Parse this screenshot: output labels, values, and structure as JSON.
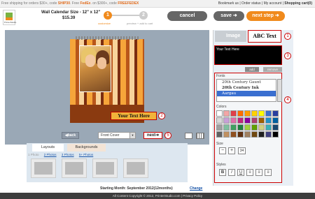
{
  "topbar": {
    "promo_a": "Free shipping for orders $30+, code ",
    "promo_code1": "SHIP30",
    "promo_b": ". Free ",
    "promo_brand": "FedEx",
    "promo_c": ". on $300+, code ",
    "promo_code2": "FREEFEDEX",
    "links": [
      "Bookmark us",
      "Order status",
      "My account",
      "Shopping cart(0)"
    ]
  },
  "header": {
    "logo_text": "PrinterStudio",
    "product_title": "Wall Calendar Size - 12\" x 12\"",
    "price": "$15.39",
    "step1_number": "1",
    "step1_label": "customize",
    "step2_number": "2",
    "step2_label": "preview + add to cart",
    "cancel_label": "cancel",
    "save_label": "save",
    "next_step_label": "next step"
  },
  "canvas": {
    "calendar_text": "Your Text Here",
    "callout2": "2",
    "callout5": "5",
    "back_label": "back",
    "page_select_value": "Front Cover",
    "next_label": "next"
  },
  "layouts": {
    "tabs": [
      "Layouts",
      "Backgrounds"
    ],
    "subtabs": [
      "1 Photo",
      "2 Photos",
      "3 Photos",
      "5+ Photos"
    ],
    "starting_month_label": "Starting Month:",
    "starting_month_value": "September 2012(12months)",
    "change_label": "Change"
  },
  "panel": {
    "tab_image": "Image",
    "tab_text": "Text",
    "tab_text_prefix": "ABC",
    "callout1": "1",
    "callout3": "3",
    "callout4": "4",
    "text_value": "Your Text Here",
    "add_label": "add",
    "remove_label": "remove",
    "fonts_label": "Fonts",
    "fonts": [
      "20th Century Gaunt",
      "20th Century Ink",
      "Aargau"
    ],
    "selected_font": "Aargau",
    "colors_label": "Colors",
    "size_label": "Size",
    "size_value": "34",
    "styles_label": "Styles"
  },
  "colors": {
    "accent": "#f08a1c",
    "swatches": [
      "#ffffff",
      "#f2a6a6",
      "#e0404a",
      "#ff6c00",
      "#ff9c00",
      "#ffd200",
      "#fffb00",
      "#3a6fd0",
      "#2a3fa0",
      "#d8d8d8",
      "#c8a0d8",
      "#e070a8",
      "#c0287a",
      "#8a00a0",
      "#b04070",
      "#a06000",
      "#2090c8",
      "#0060a0",
      "#a0a0a0",
      "#80c0a0",
      "#40a060",
      "#208040",
      "#a0d040",
      "#60a000",
      "#d0d080",
      "#3ab0b8",
      "#1a4870",
      "#606060",
      "#c09060",
      "#905020",
      "#603010",
      "#a08060",
      "#704810",
      "#202020",
      "#404080",
      "#000000"
    ]
  },
  "footer": {
    "text": "All Content Copyright © 2012, PrinterStudio.com | Privacy Policy"
  }
}
